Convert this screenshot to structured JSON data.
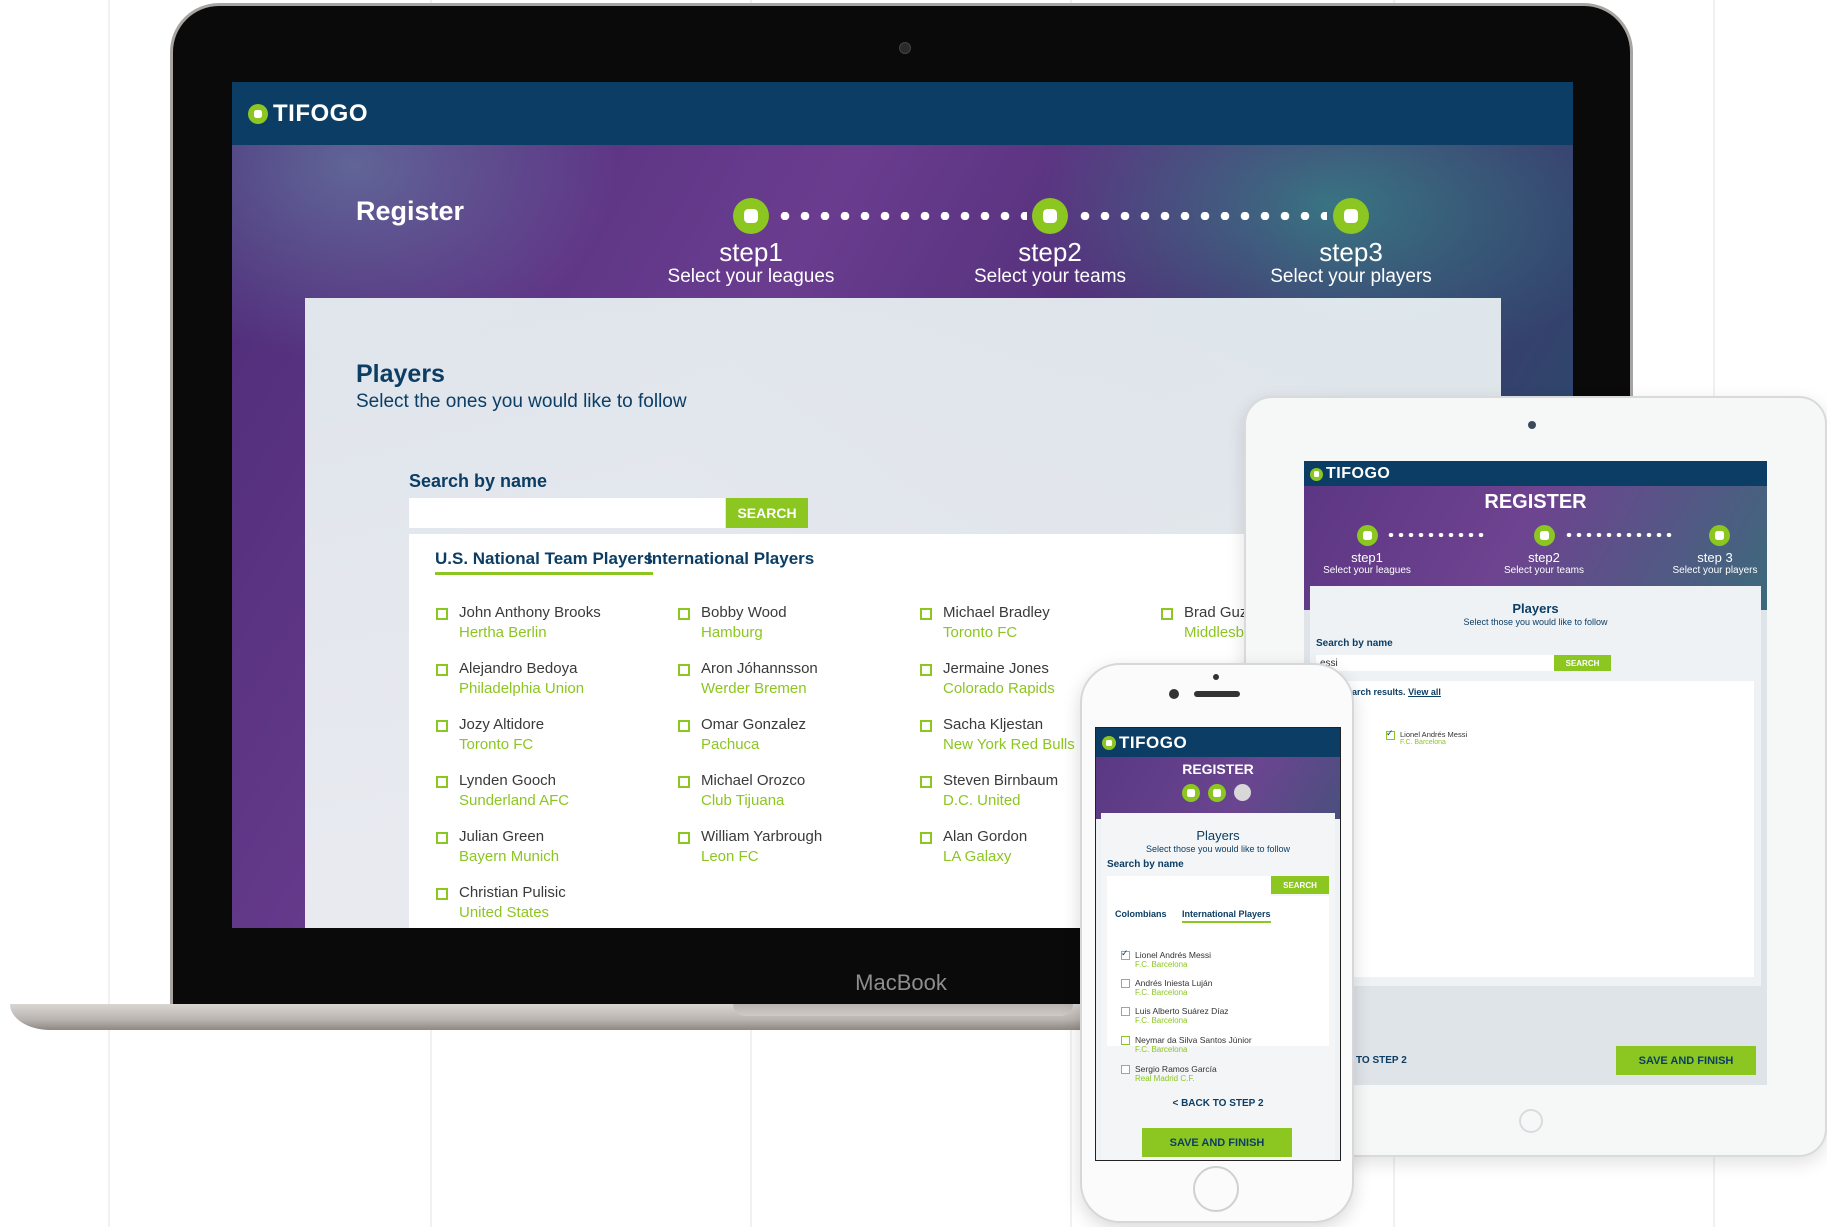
{
  "brand": {
    "logo_text": "TIFOGO",
    "accent": "#8cc620",
    "navy": "#0c3e65",
    "device_label": "MacBook"
  },
  "desktop": {
    "register_title": "Register",
    "steps": [
      {
        "num": "step1",
        "desc": "Select your leagues"
      },
      {
        "num": "step2",
        "desc": "Select your teams"
      },
      {
        "num": "step3",
        "desc": "Select your players"
      }
    ],
    "section_title": "Players",
    "section_subtitle": "Select the ones you would like to follow",
    "search_label": "Search by name",
    "search_value": "",
    "search_button": "SEARCH",
    "tabs": [
      {
        "label": "U.S. National Team Players",
        "active": true
      },
      {
        "label": "International Players",
        "active": false
      }
    ],
    "players": [
      {
        "name": "John Anthony Brooks",
        "team": "Hertha Berlin"
      },
      {
        "name": "Alejandro Bedoya",
        "team": "Philadelphia Union"
      },
      {
        "name": "Jozy Altidore",
        "team": "Toronto FC"
      },
      {
        "name": "Lynden Gooch",
        "team": "Sunderland AFC"
      },
      {
        "name": "Julian Green",
        "team": "Bayern Munich"
      },
      {
        "name": "Christian Pulisic",
        "team": "United States"
      },
      {
        "name": "Bobby Wood",
        "team": "Hamburg"
      },
      {
        "name": "Aron Jóhannsson",
        "team": "Werder Bremen"
      },
      {
        "name": "Omar Gonzalez",
        "team": "Pachuca"
      },
      {
        "name": "Michael Orozco",
        "team": "Club Tijuana"
      },
      {
        "name": "William Yarbrough",
        "team": "Leon FC"
      },
      {
        "name": "Michael Bradley",
        "team": "Toronto FC"
      },
      {
        "name": "Jermaine Jones",
        "team": "Colorado Rapids"
      },
      {
        "name": "Sacha Kljestan",
        "team": "New York Red Bulls"
      },
      {
        "name": "Steven Birnbaum",
        "team": "D.C. United"
      },
      {
        "name": "Alan Gordon",
        "team": "LA Galaxy"
      },
      {
        "name": "Brad Guz",
        "team": "Middlesb"
      }
    ]
  },
  "tablet": {
    "register_title": "REGISTER",
    "steps": [
      {
        "num": "step1",
        "desc": "Select your leagues"
      },
      {
        "num": "step2",
        "desc": "Select your teams"
      },
      {
        "num": "step 3",
        "desc": "Select your players"
      }
    ],
    "section_title": "Players",
    "section_subtitle": "Select  those you would like to follow",
    "search_label": "Search by name",
    "search_value": "essi",
    "search_button": "SEARCH",
    "results_text": "ing search results.",
    "view_all": "View all",
    "result_player": {
      "name": "Lionel Andrés Messi",
      "team": "F.C. Barcelona",
      "checked": true
    },
    "back_button": "TO STEP 2",
    "save_button": "SAVE AND FINISH"
  },
  "phone": {
    "register_title": "REGISTER",
    "section_title": "Players",
    "section_subtitle": "Select  those you would like to follow",
    "search_label": "Search by name",
    "search_button": "SEARCH",
    "tabs": [
      {
        "label": "Colombians",
        "active": false
      },
      {
        "label": "International Players",
        "active": true
      }
    ],
    "players": [
      {
        "name": "Lionel Andrés Messi",
        "team": "F.C. Barcelona",
        "checked": true
      },
      {
        "name": "Andrés Iniesta Luján",
        "team": "F.C. Barcelona",
        "checked": false
      },
      {
        "name": "Luis Alberto Suárez Díaz",
        "team": "F.C. Barcelona",
        "checked": false
      },
      {
        "name": "Neymar da Silva Santos Júnior",
        "team": "F.C. Barcelona",
        "checked": false
      },
      {
        "name": "Sergio Ramos García",
        "team": "Real Madrid C.F.",
        "checked": false
      }
    ],
    "back_button": "<  BACK TO STEP 2",
    "save_button": "SAVE AND FINISH"
  }
}
